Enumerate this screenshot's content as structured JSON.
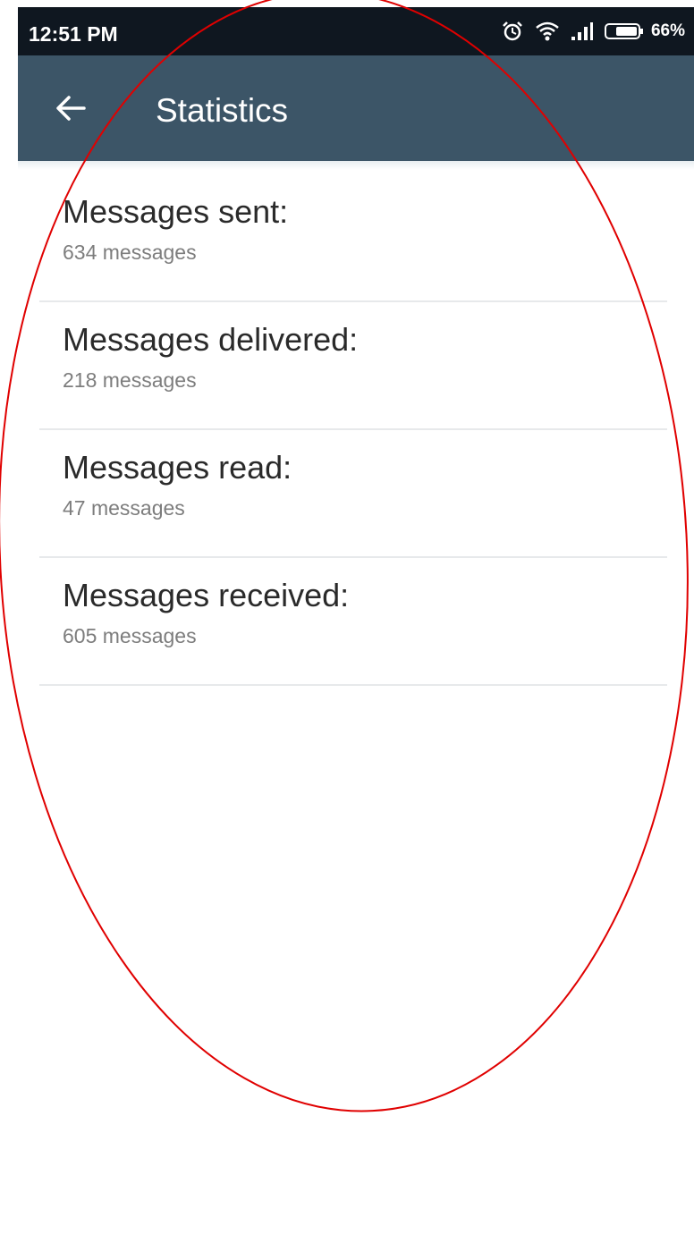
{
  "status_bar": {
    "time": "12:51 PM",
    "battery_percent": "66%",
    "icons": [
      "alarm-icon",
      "wifi-icon",
      "signal-icon",
      "battery-icon"
    ]
  },
  "app_bar": {
    "title": "Statistics",
    "back_icon": "back-arrow-icon",
    "background_color": "#3c5567"
  },
  "stats": [
    {
      "label": "Messages sent:",
      "value": "634 messages"
    },
    {
      "label": "Messages delivered:",
      "value": "218 messages"
    },
    {
      "label": "Messages read:",
      "value": "47 messages"
    },
    {
      "label": "Messages received:",
      "value": "605 messages"
    }
  ],
  "annotation": {
    "shape": "ellipse",
    "color": "#e00000"
  }
}
